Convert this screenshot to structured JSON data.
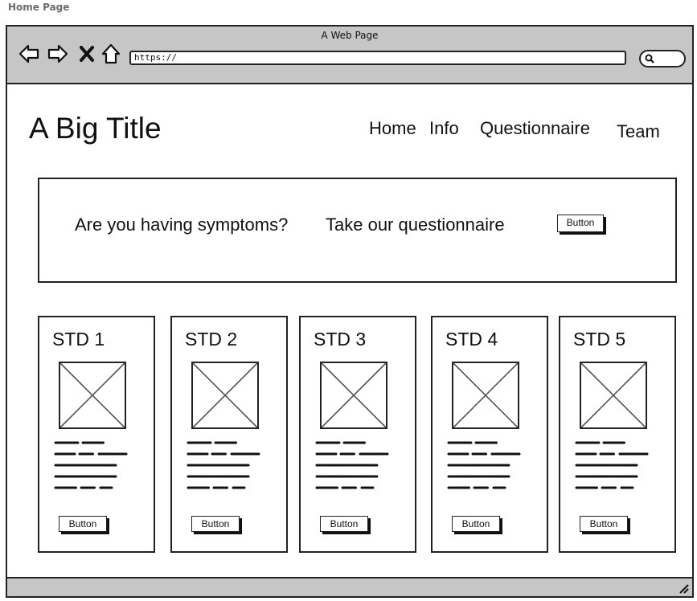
{
  "page_label": "Home Page",
  "browser": {
    "title": "A Web Page",
    "url": "https://",
    "nav_icons": [
      "back-arrow-icon",
      "forward-arrow-icon",
      "close-x-icon",
      "home-icon"
    ],
    "search_icon": "search-icon"
  },
  "header": {
    "title": "A Big Title",
    "nav": [
      "Home",
      "Info",
      "Questionnaire",
      "Team"
    ]
  },
  "hero": {
    "text_1": "Are you having symptoms?",
    "text_2": "Take our questionnaire",
    "button": "Button"
  },
  "cards": [
    {
      "title": "STD 1",
      "button": "Button"
    },
    {
      "title": "STD 2",
      "button": "Button"
    },
    {
      "title": "STD 3",
      "button": "Button"
    },
    {
      "title": "STD 4",
      "button": "Button"
    },
    {
      "title": "STD 5",
      "button": "Button"
    }
  ],
  "colors": {
    "chrome": "#c6c6c6",
    "stroke": "#222222",
    "label": "#6b6b6b"
  }
}
